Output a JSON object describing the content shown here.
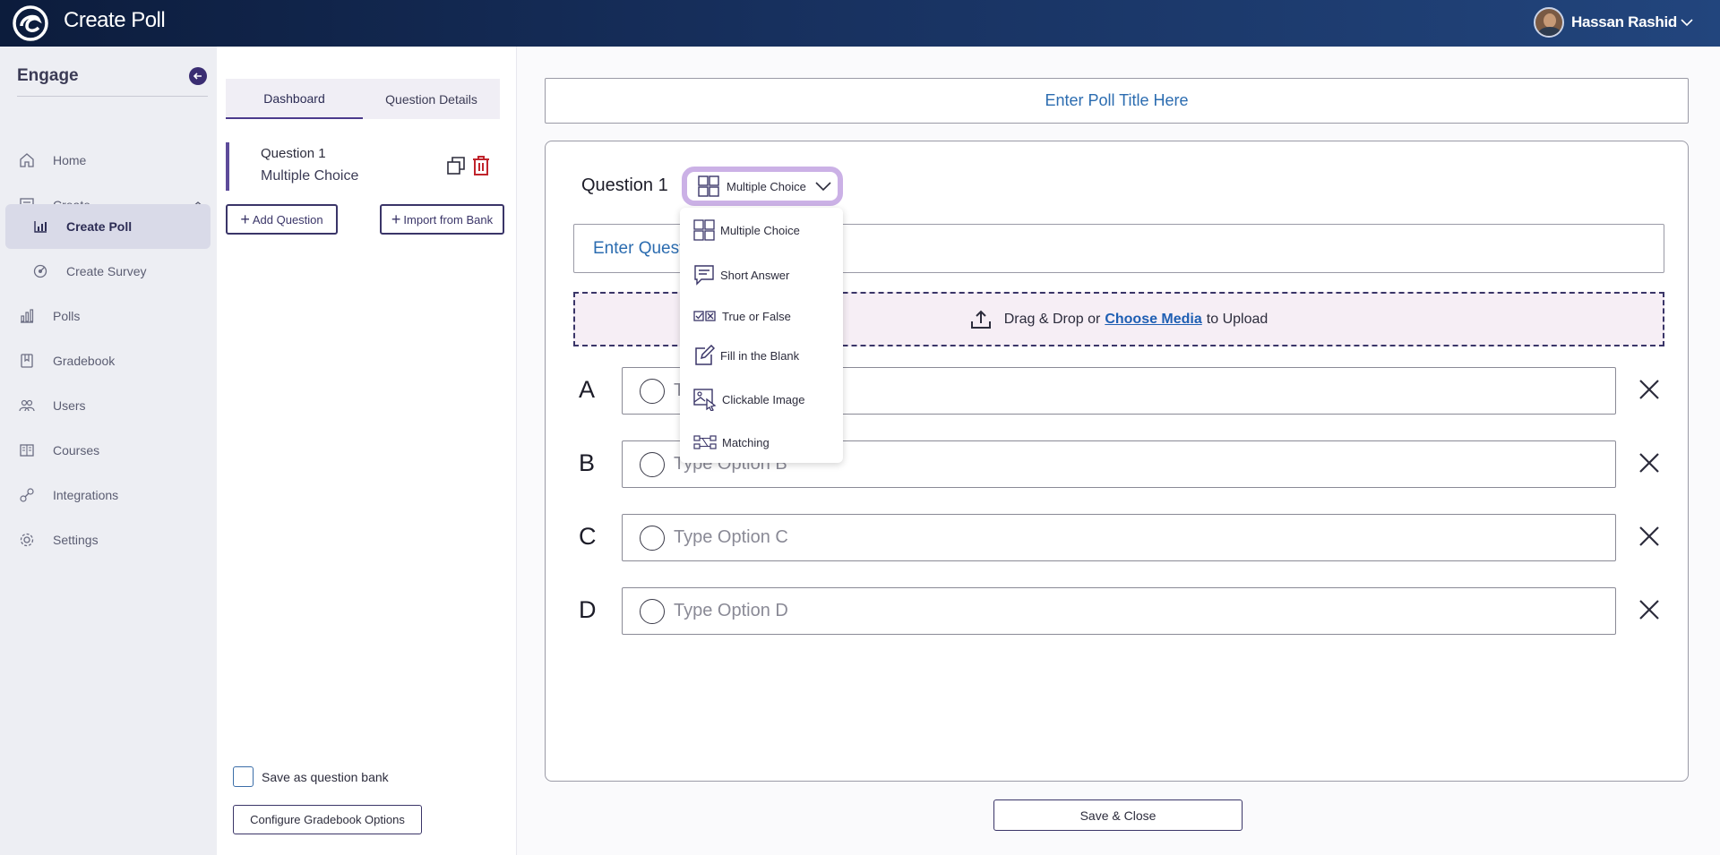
{
  "app": {
    "title": "Create Poll",
    "logo_icon": "engage-logo-icon"
  },
  "user": {
    "name": "Hassan Rashid"
  },
  "sidebar": {
    "title": "Engage",
    "items": [
      {
        "label": "Home",
        "icon": "home-icon"
      },
      {
        "label": "Create",
        "icon": "create-icon"
      },
      {
        "label": "Create Poll",
        "icon": "poll-icon"
      },
      {
        "label": "Create Survey",
        "icon": "survey-icon"
      },
      {
        "label": "Polls",
        "icon": "bar-chart-icon"
      },
      {
        "label": "Gradebook",
        "icon": "gradebook-icon"
      },
      {
        "label": "Users",
        "icon": "users-icon"
      },
      {
        "label": "Courses",
        "icon": "courses-icon"
      },
      {
        "label": "Integrations",
        "icon": "integrations-icon"
      },
      {
        "label": "Settings",
        "icon": "settings-icon"
      }
    ]
  },
  "panel": {
    "tabs": [
      {
        "label": "Dashboard"
      },
      {
        "label": "Question Details"
      }
    ],
    "questions": [
      {
        "title": "Question 1",
        "type": "Multiple Choice"
      }
    ],
    "add_question": "Add Question",
    "import_bank": "Import from Bank",
    "save_bank_label": "Save as question bank",
    "configure_gradebook": "Configure Gradebook Options"
  },
  "main": {
    "poll_title_placeholder": "Enter Poll Title Here",
    "question_label": "Question 1",
    "selected_type": "Multiple Choice",
    "question_placeholder": "Enter Quest",
    "upload": {
      "prefix": "Drag & Drop or",
      "link": "Choose Media",
      "suffix": "to Upload"
    },
    "options": [
      {
        "letter": "A",
        "placeholder": "T"
      },
      {
        "letter": "B",
        "placeholder": "Type Option B"
      },
      {
        "letter": "C",
        "placeholder": "Type Option C"
      },
      {
        "letter": "D",
        "placeholder": "Type Option D"
      }
    ],
    "save_close": "Save & Close"
  },
  "dropdown": {
    "items": [
      {
        "label": "Multiple Choice",
        "icon": "multiple-choice-icon"
      },
      {
        "label": "Short Answer",
        "icon": "short-answer-icon"
      },
      {
        "label": "True or False",
        "icon": "true-false-icon"
      },
      {
        "label": "Fill in the Blank",
        "icon": "fill-blank-icon"
      },
      {
        "label": "Clickable Image",
        "icon": "clickable-image-icon"
      },
      {
        "label": "Matching",
        "icon": "matching-icon"
      }
    ]
  },
  "colors": {
    "accent": "#3a3568",
    "brand_dark": "#0c1c3c",
    "link": "#1f5fb3",
    "danger": "#c0242c",
    "highlight": "#cbb1e6"
  }
}
